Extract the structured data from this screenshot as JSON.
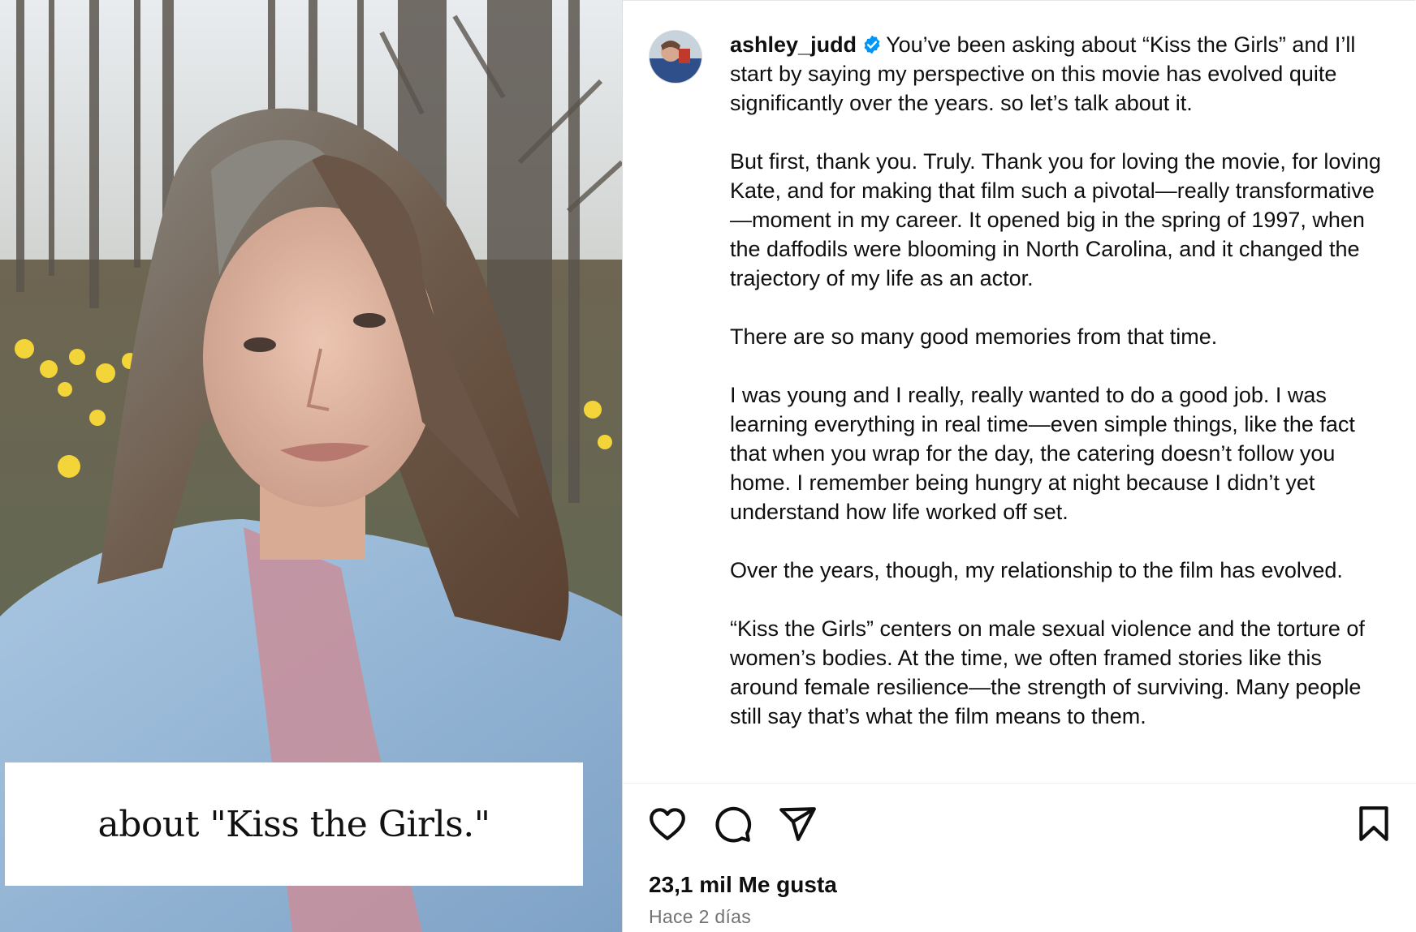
{
  "media": {
    "overlay_caption": "about \"Kiss the Girls.\""
  },
  "post": {
    "username": "ashley_judd",
    "paragraphs": [
      "You’ve been asking about “Kiss the Girls” and I’ll start by saying my perspective on this movie has evolved quite significantly over the years. so let’s talk about it.",
      "But first, thank you. Truly. Thank you for loving the movie, for loving Kate, and for making that film such a pivotal—really transformative—moment in my career. It opened big in the spring of 1997, when the daffodils were blooming in North Carolina, and it changed the trajectory of my life as an actor.",
      "There are so many good memories from that time.",
      "I was young and I really, really wanted to do a good job. I was learning everything in real time—even simple things, like the fact that when you wrap for the day, the catering doesn’t follow you home. I remember being hungry at night because I didn’t yet understand how life worked off set.",
      "Over the years, though, my relationship to the film has evolved.",
      "“Kiss the Girls” centers on male sexual violence and the torture of women’s bodies. At the time, we often framed stories like this around female resilience—the strength of surviving. Many people still say that’s what the film means to them."
    ],
    "likes": "23,1 mil Me gusta",
    "time": "Hace 2 días"
  },
  "icons": {
    "verified": "verified-badge-icon",
    "like": "heart-icon",
    "comment": "comment-bubble-icon",
    "share": "paper-plane-icon",
    "save": "bookmark-icon"
  },
  "colors": {
    "verified": "#0095f6",
    "text": "#0f0f0f",
    "muted": "#737373"
  }
}
